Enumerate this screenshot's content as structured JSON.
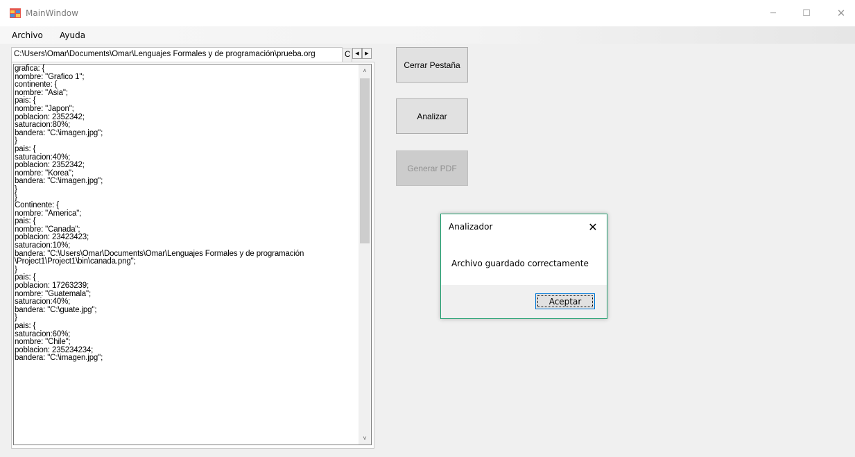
{
  "window": {
    "title": "MainWindow",
    "icon": "app-form-icon",
    "controls": {
      "minimize": "─",
      "maximize": "☐",
      "close": "✕"
    }
  },
  "menu": {
    "items": [
      {
        "label": "Archivo"
      },
      {
        "label": "Ayuda"
      }
    ]
  },
  "tabs": {
    "active_label": "C:\\Users\\Omar\\Documents\\Omar\\Lenguajes Formales y de programación\\prueba.org",
    "second_label": "C",
    "scroll_left": "◀",
    "scroll_right": "▶"
  },
  "editor": {
    "content": "grafica: {\nnombre: \"Grafico 1\";\ncontinente: {\nnombre: \"Asia\";\npais: {\nnombre: \"Japon\";\npoblacion: 2352342;\nsaturacion:80%;\nbandera: \"C:\\imagen.jpg\";\n}\npais: {\nsaturacion:40%;\npoblacion: 2352342;\nnombre: \"Korea\";\nbandera: \"C:\\imagen.jpg\";\n}\n}\nContinente: {\nnombre: \"America\";\npais: {\nnombre: \"Canada\";\npoblacion: 23423423;\nsaturacion:10%;\nbandera: \"C:\\Users\\Omar\\Documents\\Omar\\Lenguajes Formales y de programación\n\\Project1\\Project1\\bin\\canada.png\";\n}\npais: {\npoblacion: 17263239;\nnombre: \"Guatemala\";\nsaturacion:40%;\nbandera: \"C:\\guate.jpg\";\n}\npais: {\nsaturacion:60%;\nnombre: \"Chile\";\npoblacion: 235234234;\nbandera: \"C:\\imagen.jpg\";",
    "scroll_up": "˄",
    "scroll_down": "˅"
  },
  "buttons": {
    "cerrar": "Cerrar Pestaña",
    "analizar": "Analizar",
    "generar_pdf": "Generar PDF"
  },
  "dialog": {
    "title": "Analizador",
    "close": "✕",
    "message": "Archivo guardado correctamente",
    "ok": "Aceptar",
    "border_color": "#1e9e6e"
  }
}
